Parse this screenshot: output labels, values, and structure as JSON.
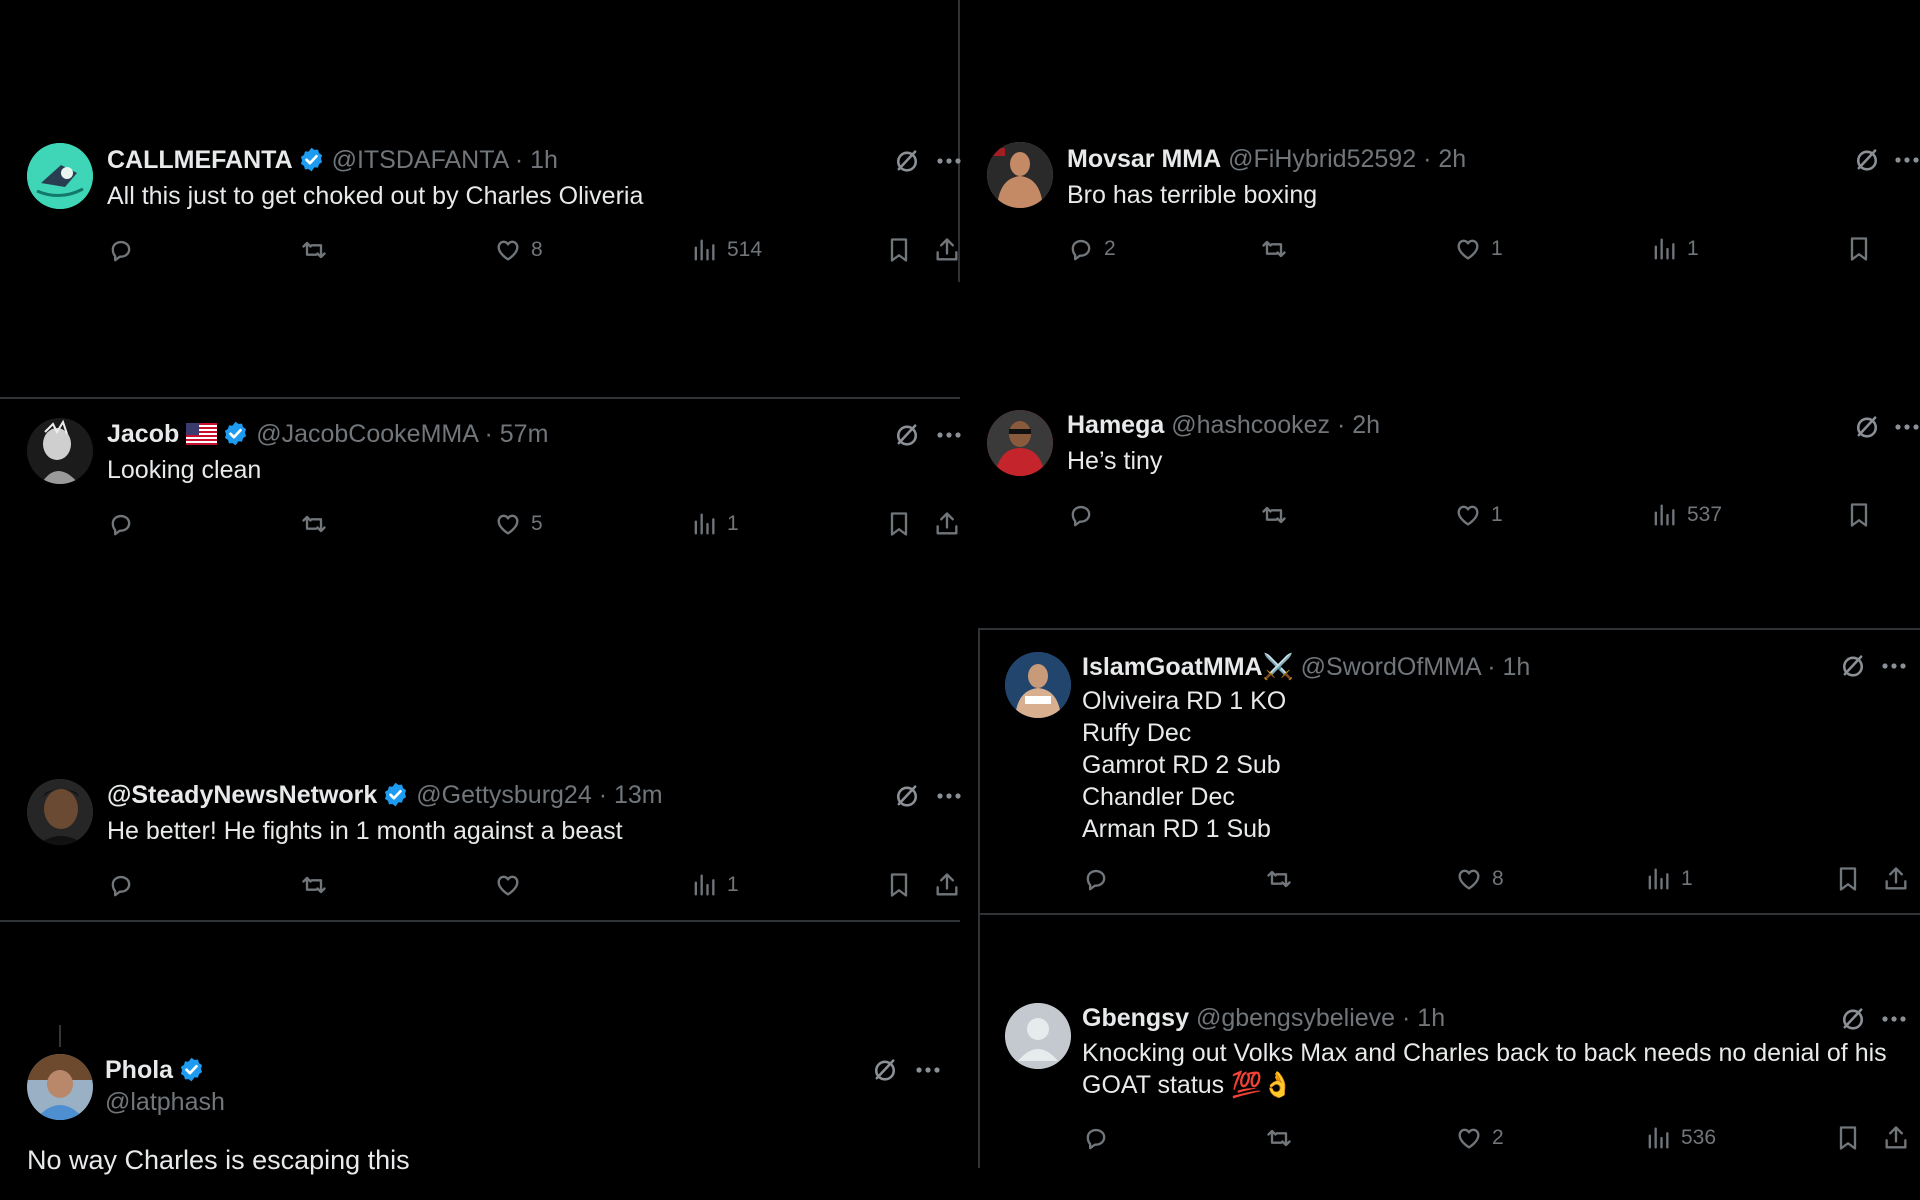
{
  "tweets": [
    {
      "name": "CALLMEFANTA",
      "verified": true,
      "flag": false,
      "handle": "@ITSDAFANTA",
      "time": "· 1h",
      "text": "All this just to get choked out by Charles Oliveria",
      "replies": "",
      "retweets": "",
      "likes": "8",
      "views": "514",
      "avatar_color": "#3ed6b6"
    },
    {
      "name": "Jacob",
      "verified": true,
      "flag": true,
      "handle": "@JacobCookeMMA",
      "time": "· 57m",
      "text": "Looking clean",
      "replies": "",
      "retweets": "",
      "likes": "5",
      "views": "1",
      "avatar_color": "#d9d9d9"
    },
    {
      "name": "@SteadyNewsNetwork",
      "verified": true,
      "flag": false,
      "handle": "@Gettysburg24",
      "time": "· 13m",
      "text": "He better! He fights in 1 month against a beast",
      "replies": "",
      "retweets": "",
      "likes": "",
      "views": "1",
      "avatar_color": "#4a3a2c"
    },
    {
      "name": "Phola",
      "verified": true,
      "flag": false,
      "handle": "@latphash",
      "time": "",
      "text": "No way Charles is escaping this",
      "avatar_color": "#5b88b5"
    },
    {
      "name": "Movsar MMA",
      "verified": false,
      "flag": false,
      "handle": "@FiHybrid52592",
      "time": "· 2h",
      "text": "Bro has terrible boxing",
      "replies": "2",
      "retweets": "",
      "likes": "1",
      "views": "1",
      "avatar_color": "#9c6b4e"
    },
    {
      "name": "Hamega",
      "verified": false,
      "flag": false,
      "handle": "@hashcookez",
      "time": "· 2h",
      "text": "He’s tiny",
      "replies": "",
      "retweets": "",
      "likes": "1",
      "views": "537",
      "avatar_color": "#b0262a"
    },
    {
      "name": "IslamGoatMMA⚔️",
      "verified": false,
      "flag": false,
      "handle": "@SwordOfMMA",
      "time": "· 1h",
      "text_lines": [
        "Olviveira RD 1 KO",
        "Ruffy Dec",
        "Gamrot RD 2 Sub",
        "Chandler Dec",
        "Arman RD 1 Sub"
      ],
      "replies": "",
      "retweets": "",
      "likes": "8",
      "views": "1",
      "avatar_color": "#2e5f9a"
    },
    {
      "name": "Gbengsy",
      "verified": false,
      "flag": false,
      "handle": "@gbengsybelieve",
      "time": "· 1h",
      "text_lines": [
        "Knocking out Volks Max and Charles back to back needs no denial of his",
        "GOAT status 💯👌"
      ],
      "replies": "",
      "retweets": "",
      "likes": "2",
      "views": "536",
      "avatar_color": "#a9b1b9"
    }
  ],
  "icons": {
    "reply": "reply-icon",
    "retweet": "retweet-icon",
    "like": "heart-icon",
    "views": "views-icon",
    "bookmark": "bookmark-icon",
    "share": "share-icon",
    "grok": "grok-icon",
    "more": "more-icon"
  },
  "colors": {
    "background": "#000000",
    "text": "#e7e9ea",
    "muted": "#71767b",
    "verified": "#1d9bf0",
    "divider": "#2f3336"
  }
}
